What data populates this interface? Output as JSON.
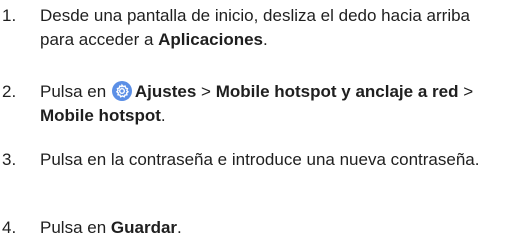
{
  "steps": [
    {
      "num": "1.",
      "t1": "Desde una pantalla de inicio, desliza el dedo hacia arriba para acceder a ",
      "b1": "Aplicaciones",
      "t2": "."
    },
    {
      "num": "2.",
      "t1": "Pulsa en ",
      "icon": "settings-gear-icon",
      "b1": "Ajustes",
      "sep1": " > ",
      "b2": "Mobile hotspot y anclaje a red",
      "sep2": " > ",
      "b3": "Mobile hotspot",
      "t2": "."
    },
    {
      "num": "3.",
      "t1": "Pulsa en la contraseña e introduce una nueva contraseña."
    },
    {
      "num": "4.",
      "t1": "Pulsa en ",
      "b1": "Guardar",
      "t2": "."
    }
  ],
  "colors": {
    "text": "#1f1f1f",
    "icon_bg": "#5b8fe6"
  }
}
